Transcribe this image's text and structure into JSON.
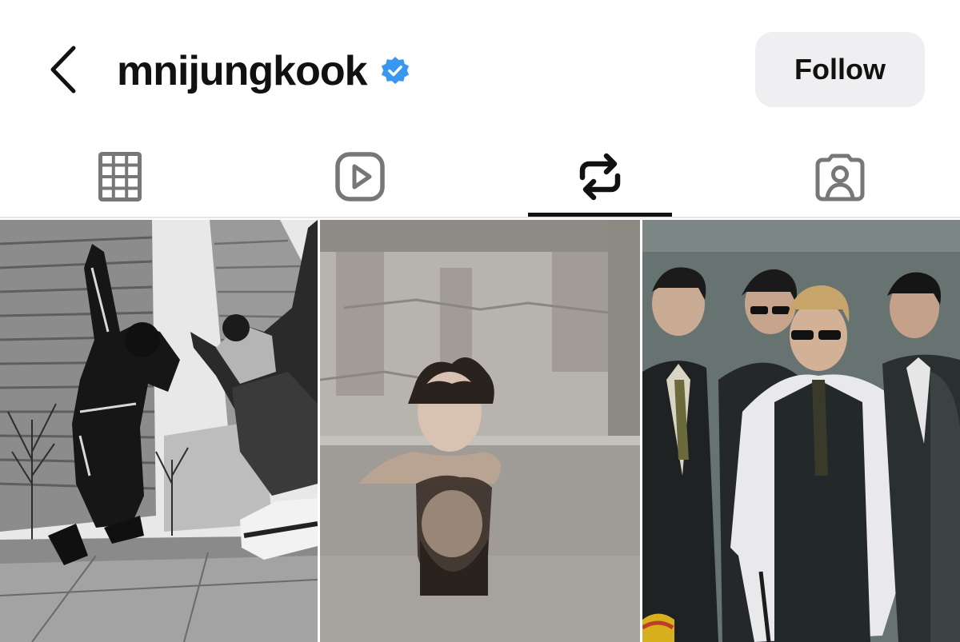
{
  "header": {
    "username": "mnijungkook",
    "verified": true,
    "follow_label": "Follow",
    "back_icon": "chevron-left-icon",
    "verified_icon": "verified-badge-icon"
  },
  "tabs": [
    {
      "id": "posts",
      "icon": "grid-icon",
      "active": false
    },
    {
      "id": "reels",
      "icon": "reels-icon",
      "active": false
    },
    {
      "id": "reposts",
      "icon": "repost-icon",
      "active": true
    },
    {
      "id": "tagged",
      "icon": "tagged-person-icon",
      "active": false
    }
  ],
  "posts": [
    {
      "id": "post-1",
      "kind": "photo"
    },
    {
      "id": "post-2",
      "kind": "photo"
    },
    {
      "id": "post-3",
      "kind": "photo"
    }
  ],
  "colors": {
    "text": "#111111",
    "follow_bg": "#efeff2",
    "verified_blue": "#3897f0",
    "icon_gray": "#777777",
    "active_indicator": "#111111"
  }
}
